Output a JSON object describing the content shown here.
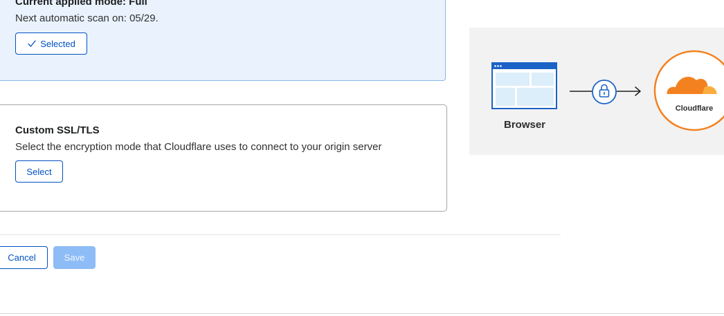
{
  "modes": {
    "current": {
      "title": "Current applied mode: Full",
      "next_scan": "Next automatic scan on: 05/29.",
      "button_label": "Selected"
    },
    "custom": {
      "title": "Custom SSL/TLS",
      "description": "Select the encryption mode that Cloudflare uses to connect to your origin server",
      "button_label": "Select"
    }
  },
  "footer": {
    "cancel_label": "Cancel",
    "save_label": "Save",
    "save_enabled": false
  },
  "diagram": {
    "browser_label": "Browser",
    "cloudflare_label": "Cloudflare",
    "icons": [
      "browser-window-icon",
      "lock-icon",
      "cloudflare-cloud-icon"
    ],
    "colors": {
      "browser_blue": "#1b63c6",
      "browser_fill": "#dceefa",
      "cloudflare_orange": "#f48120",
      "cloudflare_light": "#faad3f",
      "panel_bg": "#f2f2f2"
    }
  },
  "colors": {
    "accent": "#0051c3",
    "selected_bg": "#eaf3fd",
    "selected_border": "#86b6e8",
    "save_disabled_bg": "#8ebcf7"
  }
}
